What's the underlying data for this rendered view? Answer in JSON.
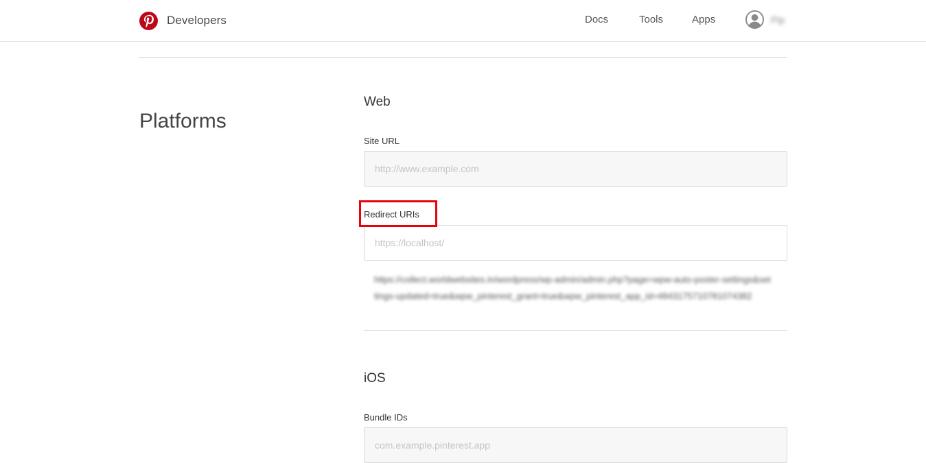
{
  "header": {
    "brand_name": "Developers",
    "logo_icon": "pinterest-logo-icon",
    "brand_color": "#bd081c",
    "nav": {
      "docs": "Docs",
      "tools": "Tools",
      "apps": "Apps"
    },
    "user": {
      "avatar_icon": "user-avatar-icon",
      "name": "Pip"
    }
  },
  "page": {
    "section_title": "Platforms"
  },
  "web": {
    "heading": "Web",
    "site_url": {
      "label": "Site URL",
      "placeholder": "http://www.example.com",
      "value": ""
    },
    "redirect_uris": {
      "label": "Redirect URIs",
      "placeholder": "https://localhost/",
      "value": "",
      "highlight_color": "#e8000b",
      "existing": [
        "https://collect.worldwebsites.in/wordpress/wp-admin/admin.php?page=wpw-auto-poster-settings&settings-updated=true&wpw_pinterest_grant=true&wpw_pinterest_app_id=4843175710781074382"
      ]
    }
  },
  "ios": {
    "heading": "iOS",
    "bundle_ids": {
      "label": "Bundle IDs",
      "placeholder": "com.example.pinterest.app",
      "value": ""
    }
  }
}
